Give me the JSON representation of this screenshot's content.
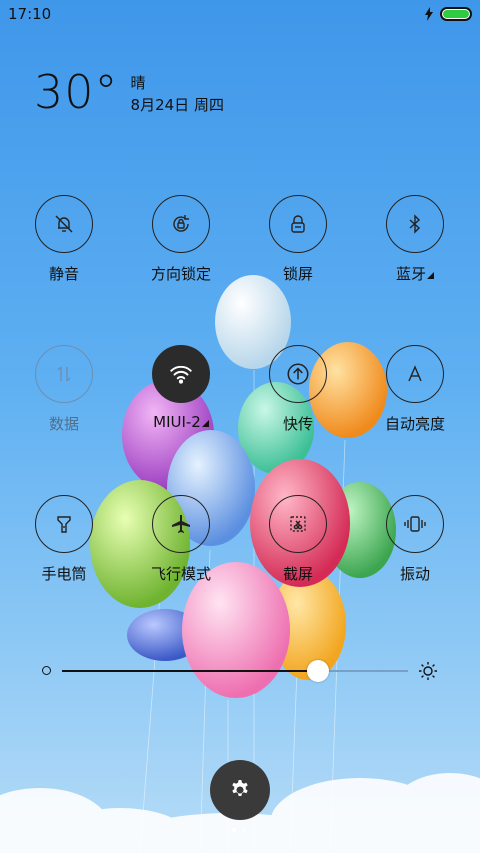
{
  "status_bar": {
    "time": "17:10",
    "battery_color": "#2ecc40"
  },
  "weather": {
    "temperature": "30°",
    "condition": "晴",
    "date": "8月24日 周四"
  },
  "toggles": [
    {
      "label": "静音",
      "icon": "bell-off-icon",
      "state": "off"
    },
    {
      "label": "方向锁定",
      "icon": "rotation-lock-icon",
      "state": "off"
    },
    {
      "label": "锁屏",
      "icon": "lock-icon",
      "state": "off"
    },
    {
      "label": "蓝牙",
      "icon": "bluetooth-icon",
      "state": "off",
      "has_more": true
    },
    {
      "label": "数据",
      "icon": "mobile-data-icon",
      "state": "disabled"
    },
    {
      "label": "MIUI-2",
      "icon": "wifi-icon",
      "state": "on",
      "has_more": true
    },
    {
      "label": "快传",
      "icon": "upload-icon",
      "state": "off"
    },
    {
      "label": "自动亮度",
      "icon": "auto-brightness-icon",
      "state": "off"
    },
    {
      "label": "手电筒",
      "icon": "flashlight-icon",
      "state": "off"
    },
    {
      "label": "飞行模式",
      "icon": "airplane-icon",
      "state": "off"
    },
    {
      "label": "截屏",
      "icon": "screenshot-icon",
      "state": "off"
    },
    {
      "label": "振动",
      "icon": "vibrate-icon",
      "state": "off"
    }
  ],
  "brightness": {
    "level": 0.74
  },
  "settings": {
    "icon": "gear-icon"
  },
  "page_indicator": {
    "pages": 2,
    "current": 1
  },
  "colors": {
    "accent_dark": "#2b2b2b",
    "sky_top": "#3f97ea",
    "sky_bottom": "#b7dcf7"
  }
}
